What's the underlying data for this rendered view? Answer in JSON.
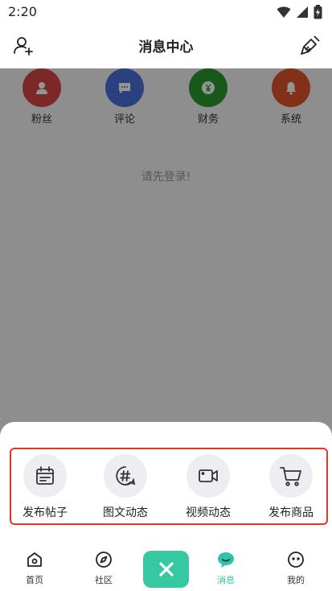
{
  "status": {
    "time": "2:20"
  },
  "header": {
    "title": "消息中心",
    "left_icon": "add-user-icon",
    "right_icon": "broom-icon"
  },
  "categories": [
    {
      "label": "粉丝",
      "color": "#d64545",
      "icon": "user-icon"
    },
    {
      "label": "评论",
      "color": "#4a6fd9",
      "icon": "comment-icon"
    },
    {
      "label": "财务",
      "color": "#2a9a2f",
      "icon": "yen-icon"
    },
    {
      "label": "系统",
      "color": "#e0552a",
      "icon": "bell-icon"
    }
  ],
  "content": {
    "login_tip": "请先登录!"
  },
  "sheet": {
    "highlight_color": "#e0392b",
    "actions": [
      {
        "label": "发布帖子",
        "icon": "calendar-post-icon"
      },
      {
        "label": "图文动态",
        "icon": "hashtag-icon"
      },
      {
        "label": "视频动态",
        "icon": "video-camera-icon"
      },
      {
        "label": "发布商品",
        "icon": "shopping-cart-icon"
      }
    ]
  },
  "tabbar": {
    "accent": "#2fc4a6",
    "tabs": [
      {
        "label": "首页",
        "icon": "home-icon",
        "active": false
      },
      {
        "label": "社区",
        "icon": "compass-icon",
        "active": false
      },
      {
        "label": "消息",
        "icon": "message-icon",
        "active": true
      },
      {
        "label": "我的",
        "icon": "profile-icon",
        "active": false
      }
    ],
    "center_icon": "close-icon"
  }
}
